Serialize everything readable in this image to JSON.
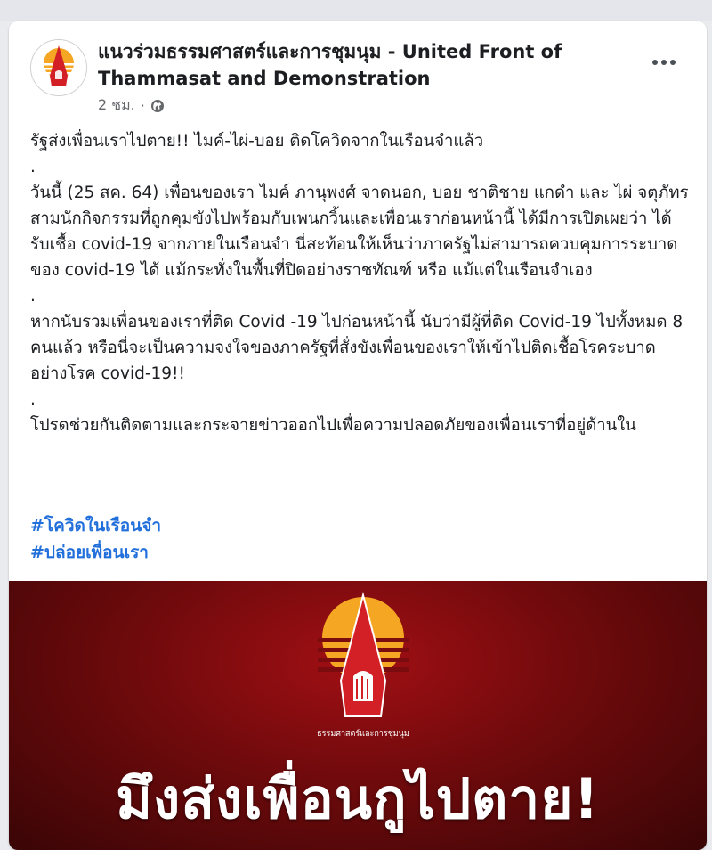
{
  "post": {
    "page_name": "แนวร่วมธรรมศาสตร์และการชุมนุม - United Front of Thammasat and Demonstration",
    "time": "2 ชม.",
    "separator": "·",
    "privacy_icon": "globe-icon",
    "body_paragraphs": [
      "รัฐส่งเพื่อนเราไปตาย!! ไมค์-ไผ่-บอย ติดโควิดจากในเรือนจำแล้ว",
      ".",
      "วันนี้ (25 สค. 64) เพื่อนของเรา ไมค์ ภานุพงศ์ จาดนอก, บอย ชาติชาย แกดำ และ ไผ่ จตุภัทร สามนักกิจกรรมที่ถูกคุมขังไปพร้อมกับเพนกวิ้นและเพื่อนเราก่อนหน้านี้ ได้มีการเปิดเผยว่า ได้รับเชื้อ covid-19 จากภายในเรือนจำ นี่สะท้อนให้เห็นว่าภาครัฐไม่สามารถควบคุมการระบาดของ covid-19 ได้ แม้กระทั่งในพื้นที่ปิดอย่างราชทัณฑ์ หรือ แม้แต่ในเรือนจำเอง",
      ".",
      "หากนับรวมเพื่อนของเราที่ติด Covid -19 ไปก่อนหน้านี้ นับว่ามีผู้ที่ติด Covid-19 ไปทั้งหมด 8 คนแล้ว หรือนี่จะเป็นความจงใจของภาครัฐที่สั่งขังเพื่อนของเราให้เข้าไปติดเชื้อโรคระบาดอย่างโรค covid-19!!",
      ".",
      "โปรดช่วยกันติดตามและกระจายข่าวออกไปเพื่อความปลอดภัยของเพื่อนเราที่อยู่ด้านใน"
    ],
    "hashtags": [
      "#โควิดในเรือนจำ",
      "#ปล่อยเพื่อนเรา"
    ],
    "image_caption": "มึงส่งเพื่อนกูไปตาย!",
    "logo_text": "ธรรมศาสตร์และการชุมนุม"
  },
  "colors": {
    "hashtag": "#216fdb",
    "logo_sun": "#f5a623",
    "logo_red": "#d32027",
    "image_bg": "#8a0c10"
  }
}
